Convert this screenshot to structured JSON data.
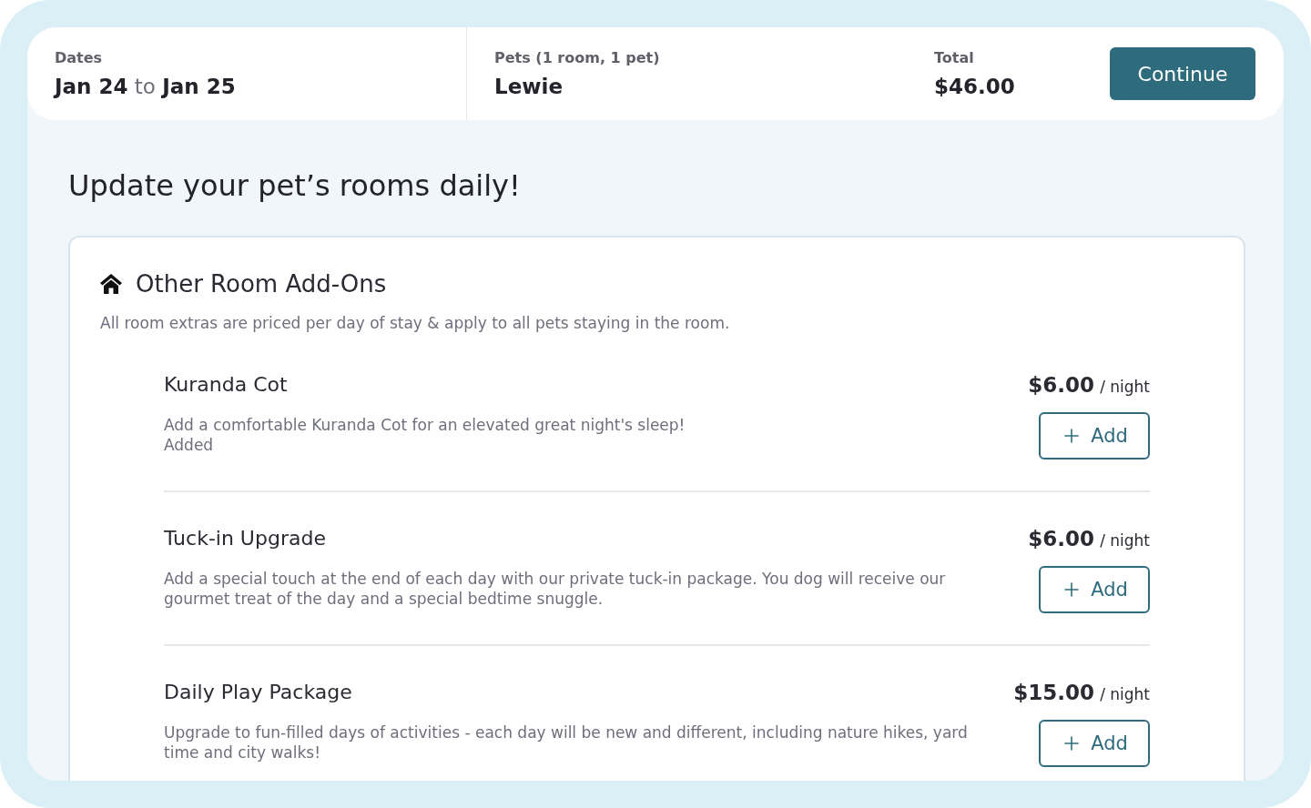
{
  "summary": {
    "dates": {
      "label": "Dates",
      "value": "**Jan 24** to **Jan 25**"
    },
    "pets": {
      "label": "Pets (1 room, 1 pet)",
      "value": "Lewie"
    },
    "total": {
      "label": "Total",
      "value": "$46.00"
    },
    "continue_button": "Continue"
  },
  "heading": "Update your pet’s rooms daily!",
  "addons_card": {
    "title": "Other Room Add-Ons",
    "subtitle": "All room extras are priced per day of stay & apply to all pets staying in the room.",
    "items": [
      {
        "name": "Kuranda Cot",
        "description": "Add a comfortable Kuranda Cot for an elevated great night's sleep!",
        "note": "Added",
        "price": "$6.00",
        "unit": "/ night",
        "button": "Add"
      },
      {
        "name": "Tuck-in Upgrade",
        "description": "Add a special touch at the end of each day with our private tuck-in package. You dog will receive our gourmet treat of the day and a special bedtime snuggle.",
        "price": "$6.00",
        "unit": "/ night",
        "button": "Add"
      },
      {
        "name": "Daily Play Package",
        "description": "Upgrade to fun-filled days of activities - each day will be new and different, including nature hikes, yard time and city walks!",
        "price": "$15.00",
        "unit": "/ night",
        "button": "Add"
      }
    ]
  }
}
